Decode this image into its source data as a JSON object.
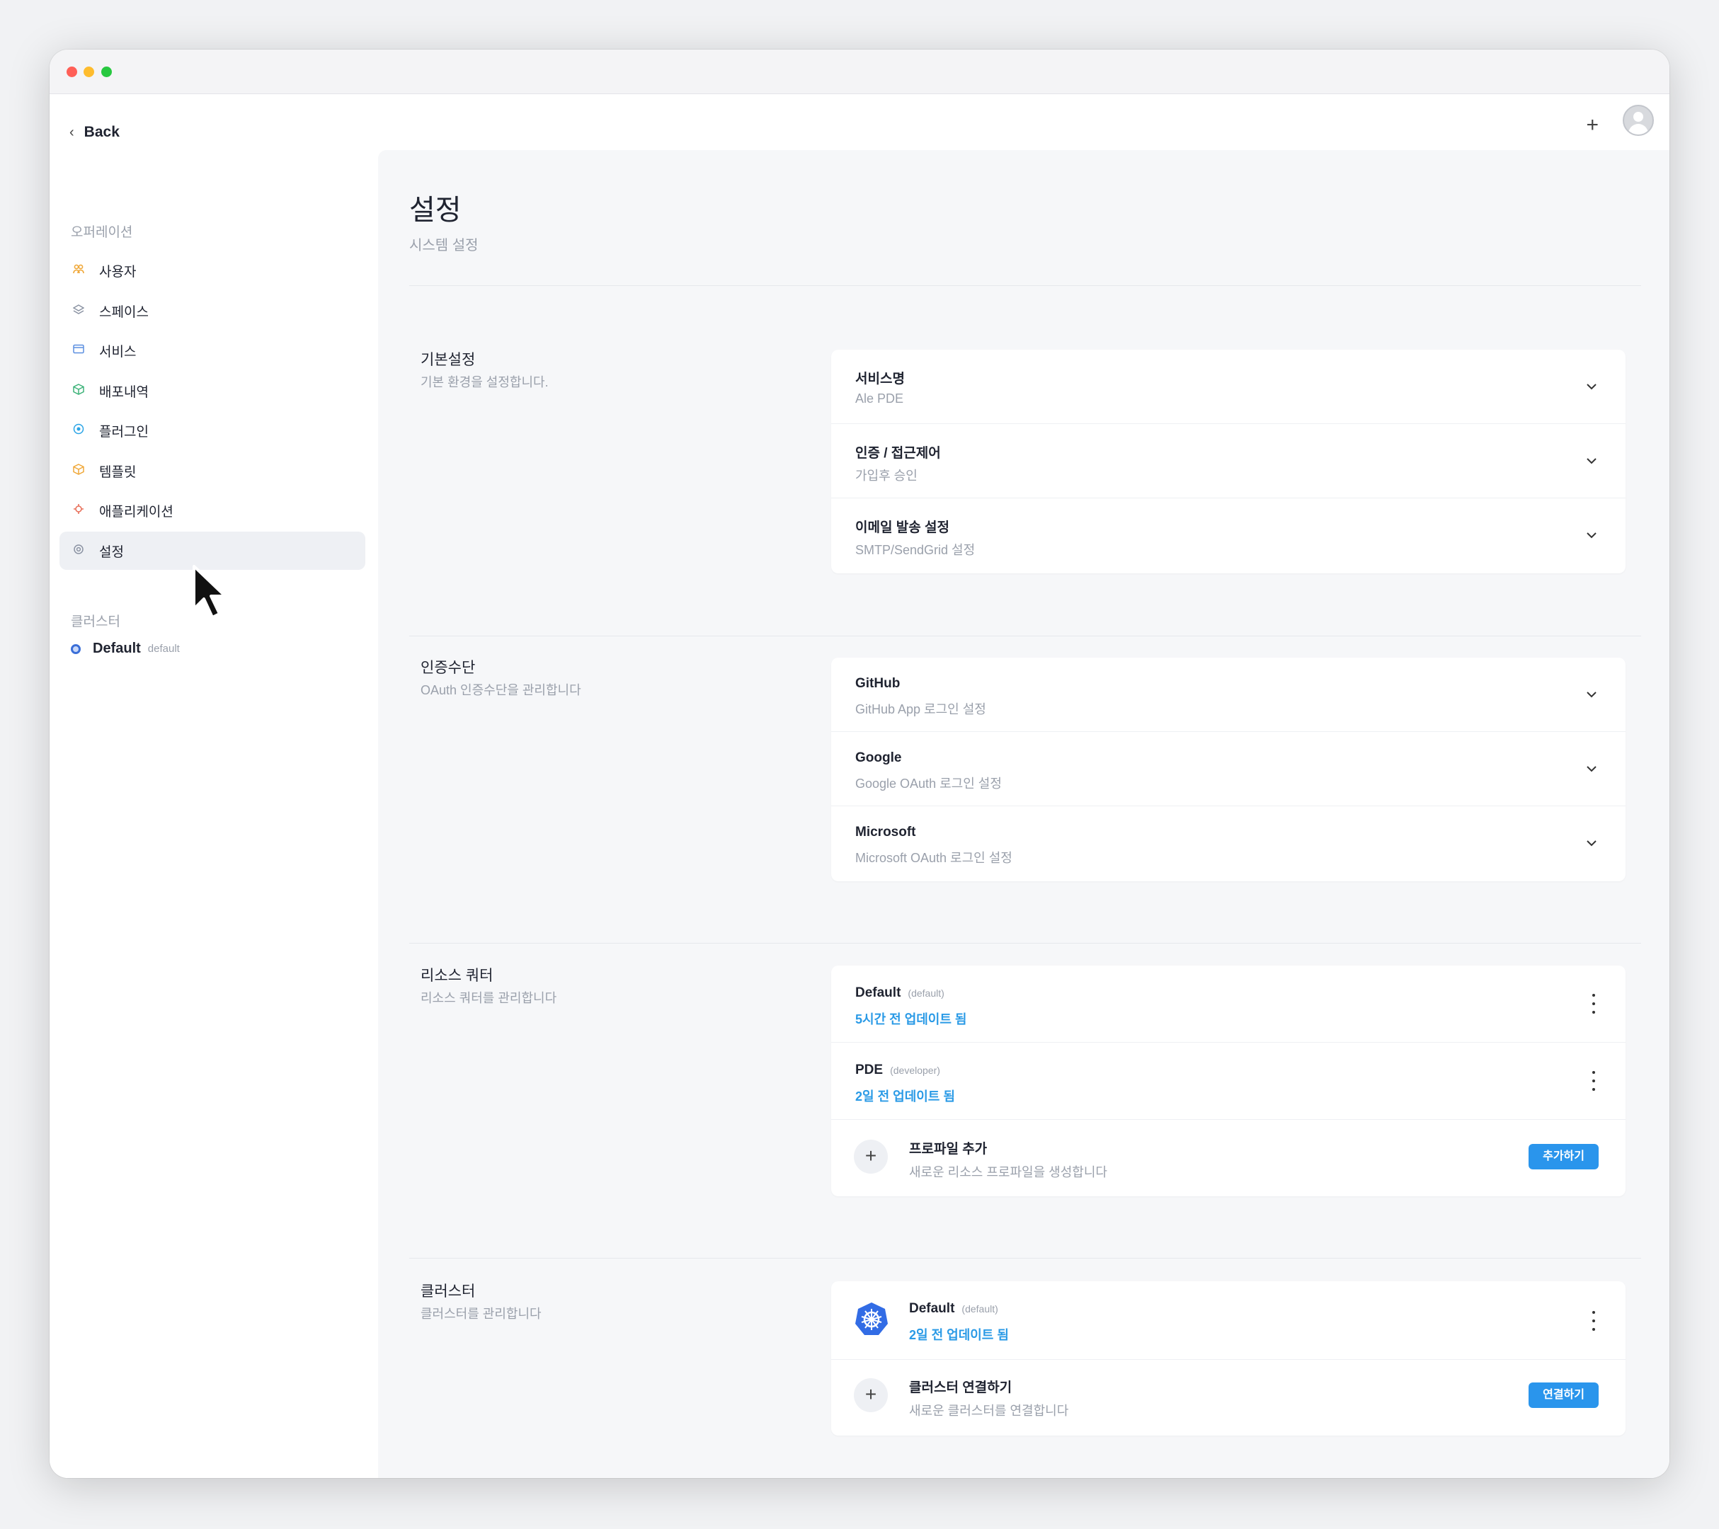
{
  "window": {
    "traffic_lights": [
      "close",
      "minimize",
      "maximize"
    ]
  },
  "header": {
    "back_label": "Back"
  },
  "sidebar": {
    "section_operation": "오퍼레이션",
    "items": [
      {
        "label": "사용자",
        "icon": "users-icon",
        "color": "#f0a93b"
      },
      {
        "label": "스페이스",
        "icon": "layers-icon",
        "color": "#8b93a3"
      },
      {
        "label": "서비스",
        "icon": "window-icon",
        "color": "#5b8fe0"
      },
      {
        "label": "배포내역",
        "icon": "package-icon",
        "color": "#3fb37a"
      },
      {
        "label": "플러그인",
        "icon": "plugin-icon",
        "color": "#2aa4e6"
      },
      {
        "label": "템플릿",
        "icon": "template-icon",
        "color": "#f0a93b"
      },
      {
        "label": "애플리케이션",
        "icon": "app-icon",
        "color": "#e8705a"
      },
      {
        "label": "설정",
        "icon": "gear-icon",
        "color": "#8b93a3",
        "active": true
      }
    ],
    "section_cluster": "클러스터",
    "cluster": {
      "name": "Default",
      "namespace": "default"
    }
  },
  "page": {
    "title": "설정",
    "subtitle": "시스템 설정"
  },
  "basic": {
    "title": "기본설정",
    "desc": "기본 환경을 설정합니다.",
    "rows": [
      {
        "title": "서비스명",
        "sub": "Ale PDE"
      },
      {
        "title": "인증 / 접근제어",
        "sub": "가입후 승인"
      },
      {
        "title": "이메일 발송 설정",
        "sub": "SMTP/SendGrid 설정"
      }
    ]
  },
  "auth": {
    "title": "인증수단",
    "desc": "OAuth 인증수단을 관리합니다",
    "rows": [
      {
        "title": "GitHub",
        "sub": "GitHub App 로그인 설정"
      },
      {
        "title": "Google",
        "sub": "Google OAuth 로그인 설정"
      },
      {
        "title": "Microsoft",
        "sub": "Microsoft OAuth 로그인 설정"
      }
    ]
  },
  "quota": {
    "title": "리소스 쿼터",
    "desc": "리소스 쿼터를 관리합니다",
    "profiles": [
      {
        "name": "Default",
        "ns": "(default)",
        "updated": "5시간 전 업데이트 됨"
      },
      {
        "name": "PDE",
        "ns": "(developer)",
        "updated": "2일 전 업데이트 됨"
      }
    ],
    "add": {
      "title": "프로파일 추가",
      "sub": "새로운 리소스 프로파일을 생성합니다",
      "button": "추가하기"
    }
  },
  "clusters": {
    "title": "클러스터",
    "desc": "클러스터를 관리합니다",
    "items": [
      {
        "name": "Default",
        "ns": "(default)",
        "updated": "2일 전 업데이트 됨"
      }
    ],
    "add": {
      "title": "클러스터 연결하기",
      "sub": "새로운 클러스터를 연결합니다",
      "button": "연결하기"
    }
  },
  "colors": {
    "accent": "#2a95ec",
    "link": "#2a9ae6",
    "k8s": "#326ce5"
  }
}
